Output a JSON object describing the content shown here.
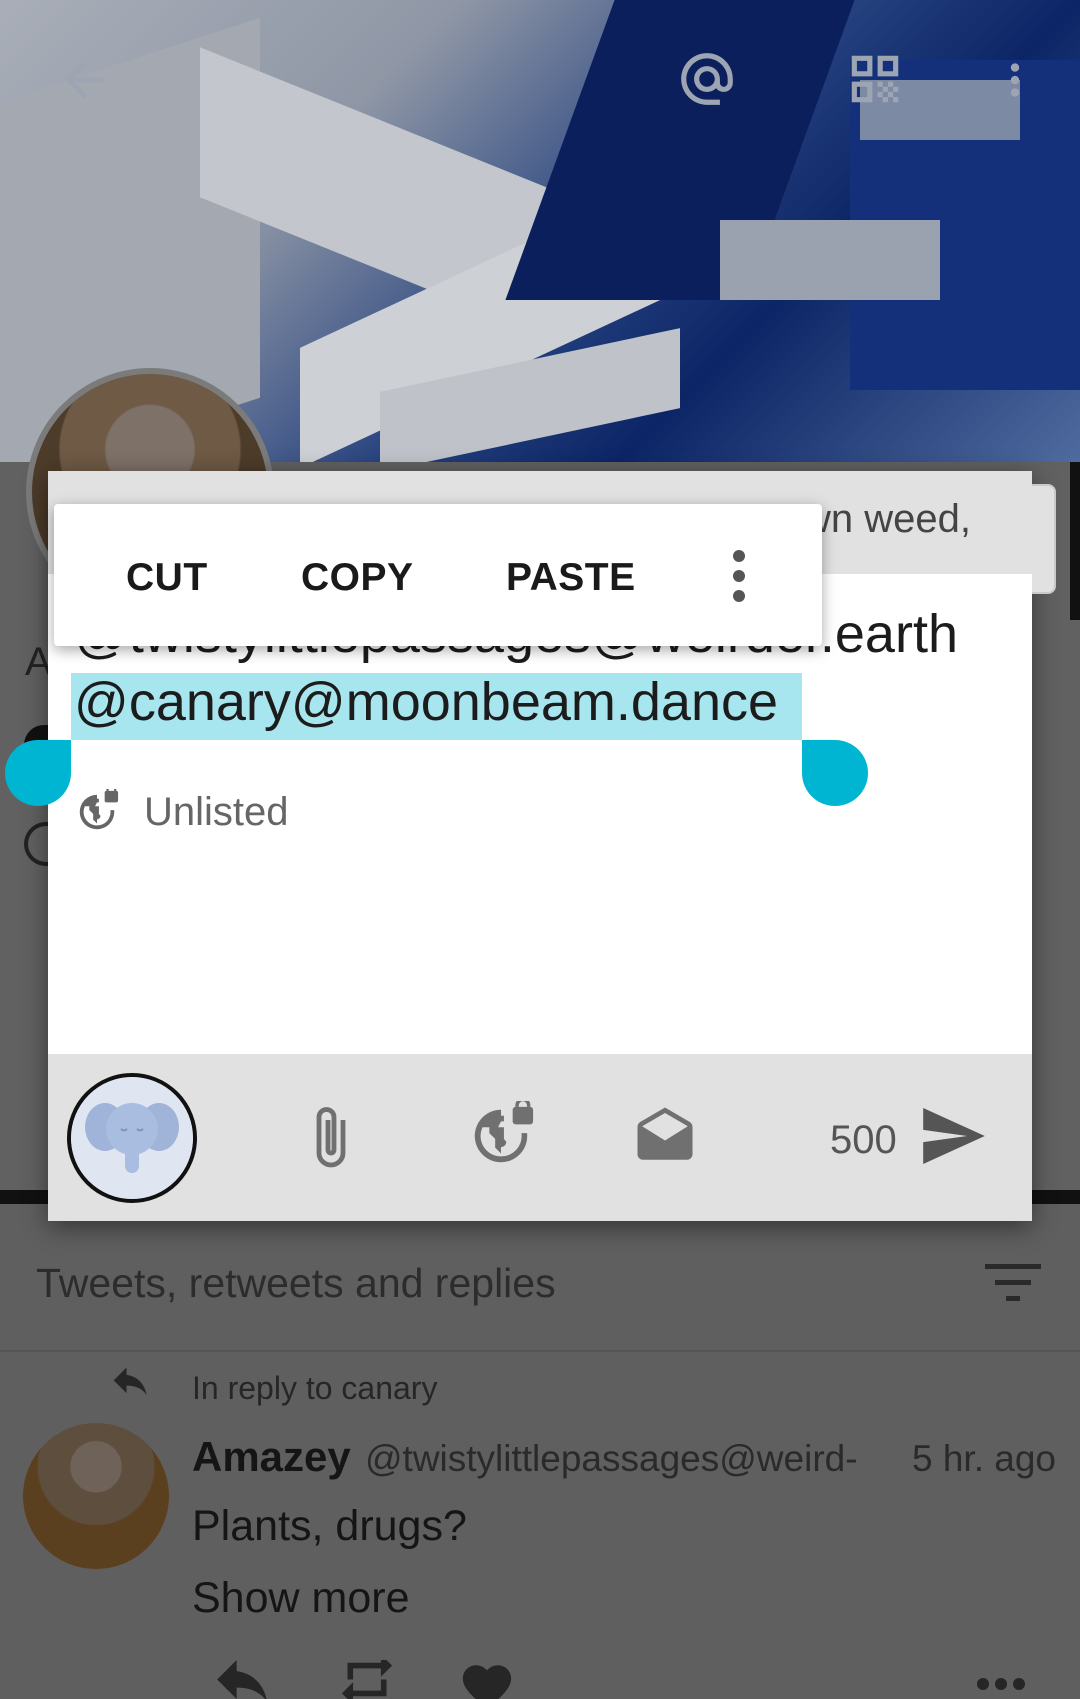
{
  "toolbar_top": {
    "back_icon": "arrow-back-icon",
    "mention_icon": "at-sign-icon",
    "qr_icon": "qr-code-icon",
    "overflow_icon": "more-vert-icon"
  },
  "compose": {
    "content_warning_visible": "wn weed,",
    "text_line1": "@twistylittlepassages@weirder.earth",
    "text_line2_selected": "@canary@moonbeam.dance",
    "visibility_label": "Unlisted",
    "char_counter": "500",
    "accent_color": "#00b5d1",
    "selection_color": "#a7e6ef"
  },
  "context_menu": {
    "cut": "CUT",
    "copy": "COPY",
    "paste": "PASTE"
  },
  "timeline": {
    "filter_label": "Tweets, retweets and replies",
    "toot": {
      "reply_context": "In reply to canary",
      "display_name": "Amazey",
      "handle": "@twistylittlepassages@weird-",
      "time": "5 hr. ago",
      "body": "Plants, drugs?",
      "show_more": "Show more"
    }
  },
  "background": {
    "partial_letter": "A"
  }
}
